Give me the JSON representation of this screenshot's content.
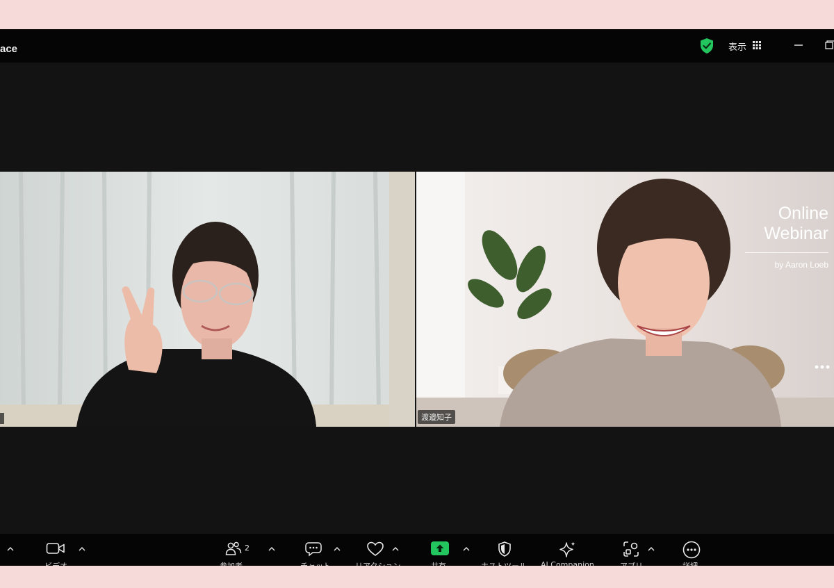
{
  "window": {
    "title": "ace",
    "view_label": "表示",
    "icons": [
      "shield-check-icon",
      "grid-icon",
      "minimize-icon",
      "maximize-icon"
    ],
    "colors": {
      "shield": "#22c55e",
      "share_button": "#22c55e",
      "background": "#131313",
      "frame": "#f6d9d9"
    }
  },
  "participants": [
    {
      "name_partial": "鳥"
    },
    {
      "name": "渡邉知子",
      "background_text": {
        "line1": "Online",
        "line2": "Webinar",
        "byline": "by Aaron Loeb"
      }
    }
  ],
  "toolbar": {
    "participants_count": "2",
    "items": [
      {
        "icon": "microphone-icon",
        "label": ""
      },
      {
        "icon": "video-camera-icon",
        "label": "ビデオ"
      },
      {
        "icon": "participants-icon",
        "label": "参加者"
      },
      {
        "icon": "chat-icon",
        "label": "チャット"
      },
      {
        "icon": "reactions-heart-icon",
        "label": "リアクション"
      },
      {
        "icon": "share-screen-icon",
        "label": "共有"
      },
      {
        "icon": "host-tools-shield-icon",
        "label": "ホストツール"
      },
      {
        "icon": "ai-companion-sparkle-icon",
        "label": "AI Companion"
      },
      {
        "icon": "apps-icon",
        "label": "アプリ"
      },
      {
        "icon": "more-icon",
        "label": "詳細"
      }
    ]
  }
}
